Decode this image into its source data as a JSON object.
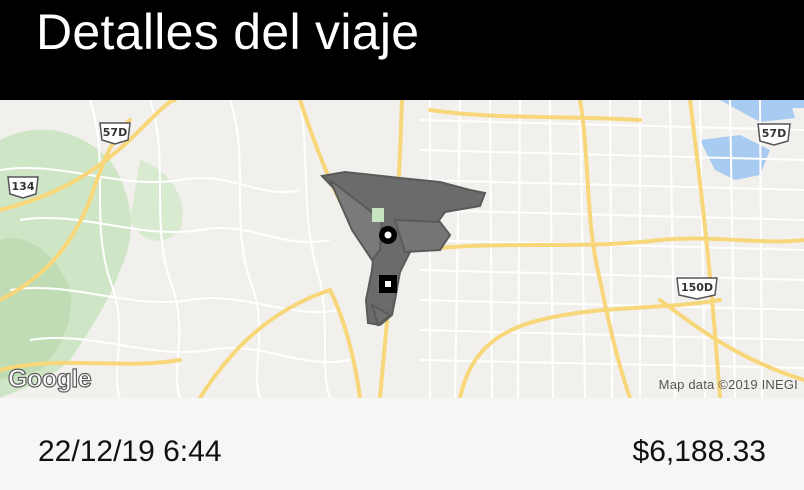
{
  "header": {
    "title": "Detalles del viaje"
  },
  "map": {
    "provider_logo": "Google",
    "attribution": "Map data ©2019 INEGI",
    "route_color": "#6b6b6b",
    "road_color": "#f8d77a",
    "water_color": "#a8cbf1",
    "park_color": "#c5e4bf",
    "shields": [
      "57D",
      "134",
      "57D",
      "150D"
    ],
    "pickup_marker": "pickup-circle-icon",
    "dropoff_marker": "dropoff-square-icon"
  },
  "trip": {
    "datetime": "22/12/19 6:44",
    "fare": "$6,188.33"
  }
}
